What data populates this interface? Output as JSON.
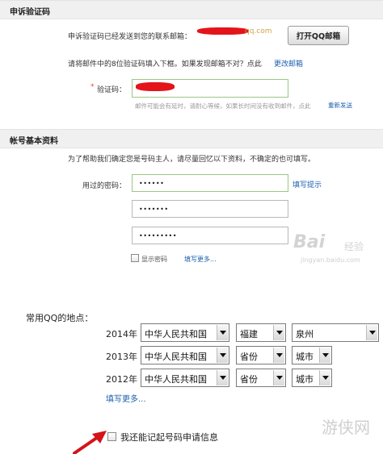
{
  "appeal_section": {
    "title": "申诉验证码",
    "sent_prefix": "申诉验证码已经发送到您的联系邮箱：",
    "email_suffix": "qq.com",
    "open_button": "打开QQ邮箱",
    "instruction": "请将邮件中的8位验证码填入下框。如果发现邮箱不对？点此",
    "change_email_link": "更改邮箱",
    "code_required_mark": "*",
    "code_label": "验证码：",
    "delay_hint": "邮件可能会有延时，请耐心等候，如果长时间没有收到邮件，点此",
    "resend_link": "重新发送"
  },
  "account_section": {
    "title": "帐号基本资料",
    "intro": "为了帮助我们确定您是号码主人，请尽量回忆以下资料，不确定的也可填写。",
    "password_label": "用过的密码：",
    "fill_hint_link": "填写提示",
    "passwords": [
      "••••••",
      "•••••••",
      "•••••••••"
    ],
    "show_password_label": "显示密码",
    "fill_more_link": "填写更多..."
  },
  "locations": {
    "label": "常用QQ的地点：",
    "rows": [
      {
        "year": "2014年",
        "country": "中华人民共和国",
        "province": "福建",
        "city": "泉州"
      },
      {
        "year": "2013年",
        "country": "中华人民共和国",
        "province": "省份",
        "city": "城市"
      },
      {
        "year": "2012年",
        "country": "中华人民共和国",
        "province": "省份",
        "city": "城市"
      }
    ],
    "fill_more_link": "填写更多..."
  },
  "remember_application": {
    "label": "我还能记起号码申请信息"
  },
  "watermarks": {
    "baidu_name": "Bai",
    "baidu_suffix": "经验",
    "baidu_url": "jingyan.baidu.com",
    "site_name": "游侠网"
  },
  "colors": {
    "link": "#1d5fae",
    "input_border_active": "#9dc783",
    "redaction": "#e4141b",
    "email_domain": "#d4a24a",
    "arrow": "#d3141b"
  }
}
